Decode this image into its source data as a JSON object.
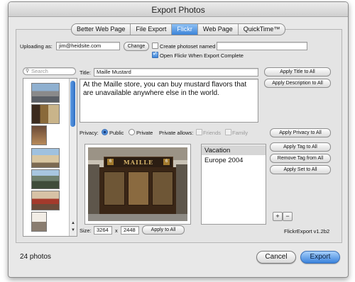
{
  "window": {
    "title": "Export Photos"
  },
  "tabs": [
    "Better Web Page",
    "File Export",
    "Flickr",
    "Web Page",
    "QuickTime™"
  ],
  "upload": {
    "uploading_as_label": "Uploading as:",
    "account": "jim@heidsite.com",
    "change_button": "Change",
    "create_photoset_label": "Create photoset named",
    "photoset_name": "",
    "open_flickr_label": "Open Flickr When Export Complete"
  },
  "search": {
    "placeholder": "Search"
  },
  "details": {
    "title_label": "Title:",
    "title_value": "Maille Mustard",
    "apply_title_button": "Apply Title to All",
    "description": "At the Maille store, you can buy mustard flavors that are unavailable anywhere else in the world.",
    "apply_description_button": "Apply Description to All"
  },
  "privacy": {
    "label": "Privacy:",
    "public_label": "Public",
    "private_label": "Private",
    "allows_label": "Private allows:",
    "friends_label": "Friends",
    "family_label": "Family",
    "apply_privacy_button": "Apply Privacy to All"
  },
  "tags": {
    "items": [
      "Vacation",
      "Europe 2004"
    ],
    "apply_tag_button": "Apply Tag to All",
    "remove_tag_button": "Remove Tag from All",
    "apply_set_button": "Apply Set to All",
    "add_label": "+",
    "remove_label": "−"
  },
  "size": {
    "label": "Size:",
    "width": "3264",
    "separator": "x",
    "height": "2448",
    "apply_button": "Apply to All"
  },
  "photo_sign": {
    "text": "MAILLE",
    "emblem_left": "6",
    "emblem_right": "6"
  },
  "version": "FlickrExport v1.2b2",
  "footer": {
    "photo_count": "24 photos",
    "cancel_button": "Cancel",
    "export_button": "Export"
  }
}
